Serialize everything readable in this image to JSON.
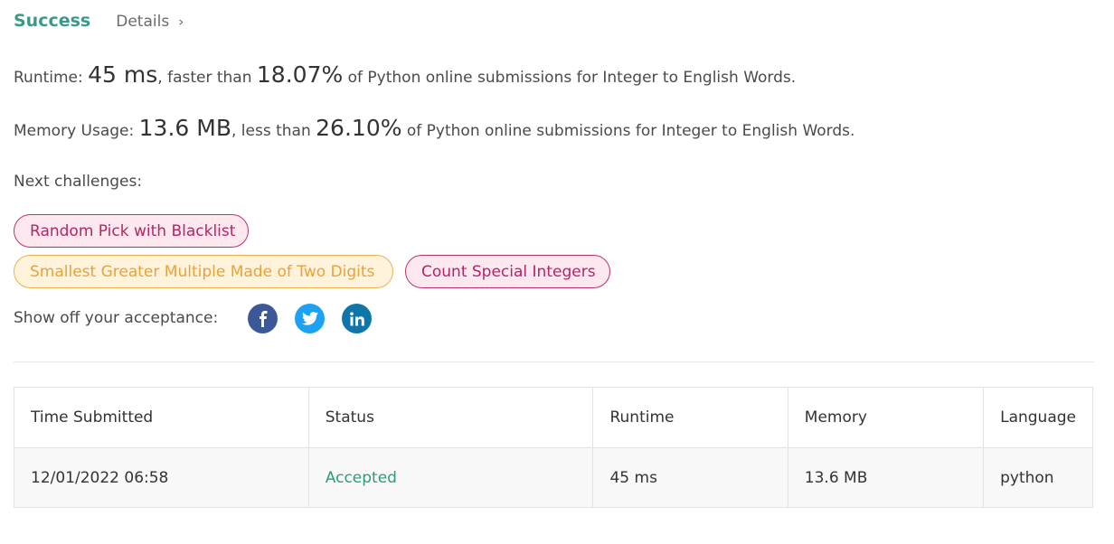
{
  "header": {
    "status": "Success",
    "details_label": "Details",
    "details_chevron": "›"
  },
  "runtime": {
    "label": "Runtime:",
    "value": "45 ms",
    "mid": ", faster than",
    "percent": "18.07%",
    "suffix": "of Python online submissions for Integer to English Words."
  },
  "memory": {
    "label": "Memory Usage:",
    "value": "13.6 MB",
    "mid": ", less than",
    "percent": "26.10%",
    "suffix": "of Python online submissions for Integer to English Words."
  },
  "next": {
    "label": "Next challenges:",
    "items": [
      {
        "title": "Random Pick with Blacklist",
        "difficulty": "hard"
      },
      {
        "title": "Smallest Greater Multiple Made of Two Digits",
        "difficulty": "medium"
      },
      {
        "title": "Count Special Integers",
        "difficulty": "hard"
      }
    ]
  },
  "share": {
    "label": "Show off your acceptance:",
    "icons": [
      "facebook-icon",
      "twitter-icon",
      "linkedin-icon"
    ]
  },
  "table": {
    "headers": [
      "Time Submitted",
      "Status",
      "Runtime",
      "Memory",
      "Language"
    ],
    "rows": [
      {
        "time": "12/01/2022 06:58",
        "status": "Accepted",
        "runtime": "45 ms",
        "memory": "13.6 MB",
        "language": "python"
      }
    ]
  },
  "colors": {
    "success": "#3a9a8a",
    "hard_border": "#c0316b",
    "medium_border": "#f0b04e",
    "accepted": "#2e9a7e",
    "facebook": "#3b5998",
    "twitter": "#1da1f2",
    "linkedin": "#0e76a8"
  }
}
